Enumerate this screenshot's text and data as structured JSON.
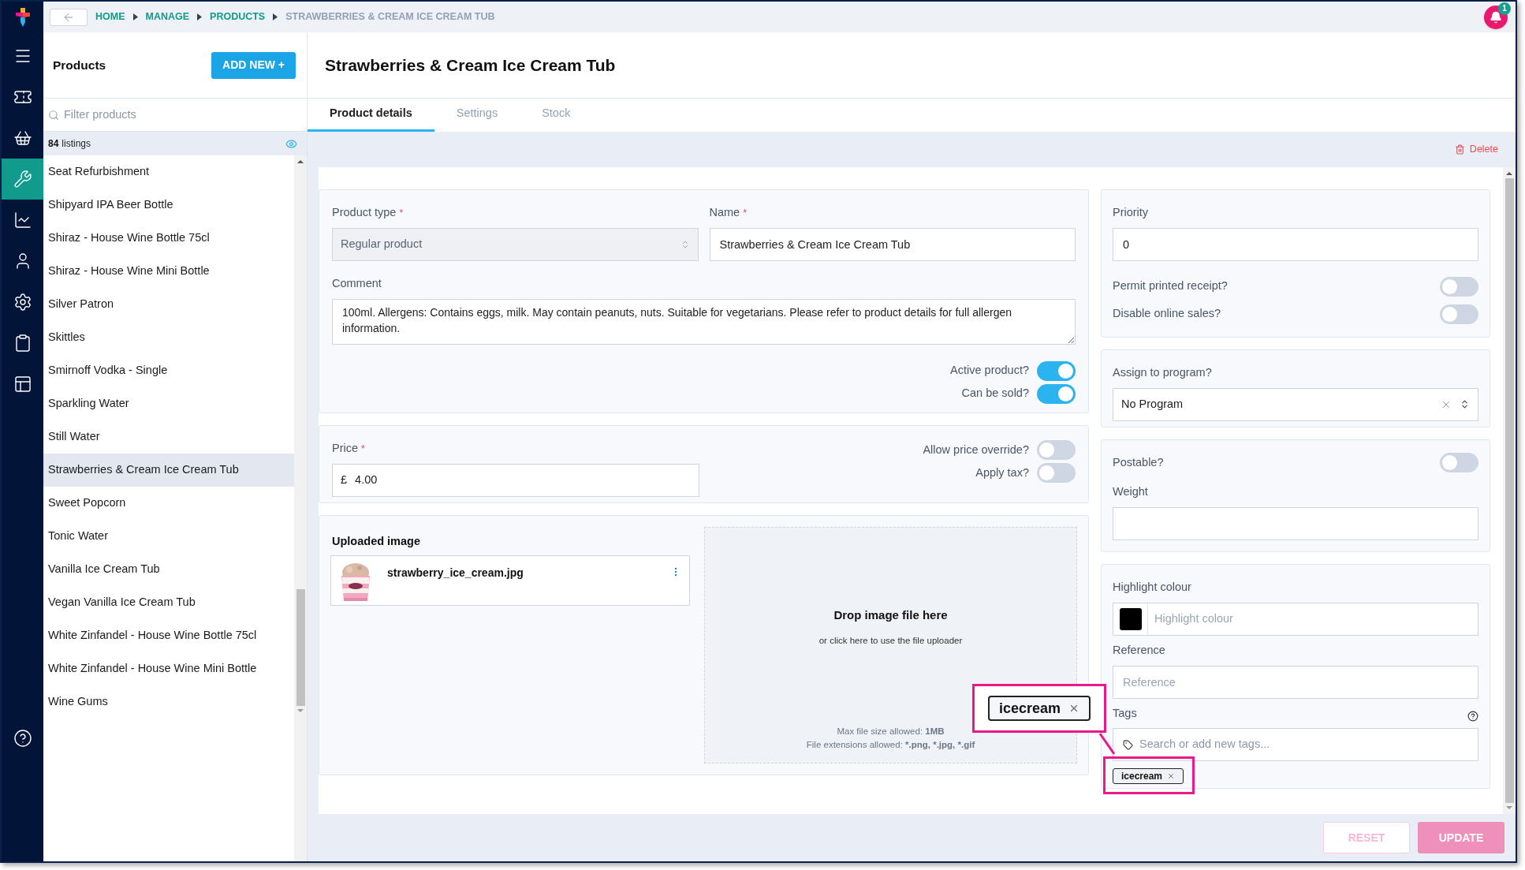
{
  "breadcrumb": [
    {
      "label": "HOME",
      "current": false
    },
    {
      "label": "MANAGE",
      "current": false
    },
    {
      "label": "PRODUCTS",
      "current": false
    },
    {
      "label": "STRAWBERRIES & CREAM ICE CREAM TUB",
      "current": true
    }
  ],
  "notification_count": "1",
  "nav": [
    {
      "selected": false
    },
    {
      "selected": false
    },
    {
      "selected": false
    },
    {
      "selected": true
    },
    {
      "selected": false
    },
    {
      "selected": false
    },
    {
      "selected": false
    },
    {
      "selected": false
    },
    {
      "selected": false
    },
    {
      "selected": false
    }
  ],
  "products_panel": {
    "title": "Products",
    "add_button": "ADD NEW +",
    "filter": {
      "placeholder": "Filter products"
    },
    "count": "84",
    "count_label": "listings",
    "items": [
      {
        "label": "Seat Refurbishment",
        "selected": false
      },
      {
        "label": "Shipyard IPA Beer Bottle",
        "selected": false
      },
      {
        "label": "Shiraz - House Wine Bottle 75cl",
        "selected": false
      },
      {
        "label": "Shiraz - House Wine Mini Bottle",
        "selected": false
      },
      {
        "label": "Silver Patron",
        "selected": false
      },
      {
        "label": "Skittles",
        "selected": false
      },
      {
        "label": "Smirnoff Vodka - Single",
        "selected": false
      },
      {
        "label": "Sparkling Water",
        "selected": false
      },
      {
        "label": "Still Water",
        "selected": false
      },
      {
        "label": "Strawberries & Cream Ice Cream Tub",
        "selected": true
      },
      {
        "label": "Sweet Popcorn",
        "selected": false
      },
      {
        "label": "Tonic Water",
        "selected": false
      },
      {
        "label": "Vanilla Ice Cream Tub",
        "selected": false
      },
      {
        "label": "Vegan Vanilla Ice Cream Tub",
        "selected": false
      },
      {
        "label": "White Zinfandel - House Wine Bottle 75cl",
        "selected": false
      },
      {
        "label": "White Zinfandel - House Wine Mini Bottle",
        "selected": false
      },
      {
        "label": "Wine Gums",
        "selected": false
      }
    ]
  },
  "product": {
    "title": "Strawberries & Cream Ice Cream Tub",
    "tabs": [
      {
        "label": "Product details",
        "selected": true
      },
      {
        "label": "Settings",
        "selected": false
      },
      {
        "label": "Stock",
        "selected": false
      }
    ],
    "delete": "Delete"
  },
  "details": {
    "product_type": {
      "label": "Product type",
      "required_mark": "*",
      "value": "Regular product",
      "disabled": true
    },
    "name": {
      "label": "Name",
      "required_mark": "*",
      "value": "Strawberries & Cream Ice Cream Tub"
    },
    "comment": {
      "label": "Comment",
      "value": "100ml. Allergens: Contains eggs, milk. May contain peanuts, nuts. Suitable for vegetarians. Please refer to product details for full allergen information."
    },
    "status_toggles": [
      {
        "label": "Active product?",
        "on": true
      },
      {
        "label": "Can be sold?",
        "on": true
      }
    ],
    "price": {
      "label": "Price",
      "required_mark": "*",
      "currency": "£",
      "value": "4.00"
    },
    "price_toggles": [
      {
        "label": "Allow price override?",
        "on": false
      },
      {
        "label": "Apply tax?",
        "on": false
      }
    ],
    "uploaded_image": {
      "heading": "Uploaded image",
      "file_name": "strawberry_ice_cream.jpg"
    },
    "dropzone": {
      "title": "Drop image file here",
      "subtitle": "or click here to use the file uploader",
      "max_size": "Max file size allowed: **1MB**",
      "extensions": "File extensions allowed: ***.png, *.jpg, *.gif**"
    }
  },
  "options": {
    "priority": {
      "label": "Priority",
      "value": "0"
    },
    "option_toggles": [
      {
        "label": "Permit printed receipt?",
        "on": false
      },
      {
        "label": "Disable online sales?",
        "on": false
      }
    ],
    "program": {
      "label": "Assign to program?",
      "value": "No Program"
    },
    "postable": {
      "label": "Postable?",
      "on": false
    },
    "weight": {
      "label": "Weight"
    },
    "highlight_colour": {
      "label": "Highlight colour",
      "placeholder": "Highlight colour",
      "color": "#000000"
    },
    "reference": {
      "label": "Reference",
      "placeholder": "Reference"
    },
    "tags": {
      "label": "Tags",
      "placeholder": "Search or add new tags...",
      "items": [
        "icecream"
      ]
    }
  },
  "footer": {
    "buttons": [
      {
        "label": "RESET",
        "kind": "secondary",
        "disabled": true
      },
      {
        "label": "UPDATE",
        "kind": "primary",
        "disabled": true
      }
    ]
  },
  "callout": {
    "tag": "icecream"
  }
}
